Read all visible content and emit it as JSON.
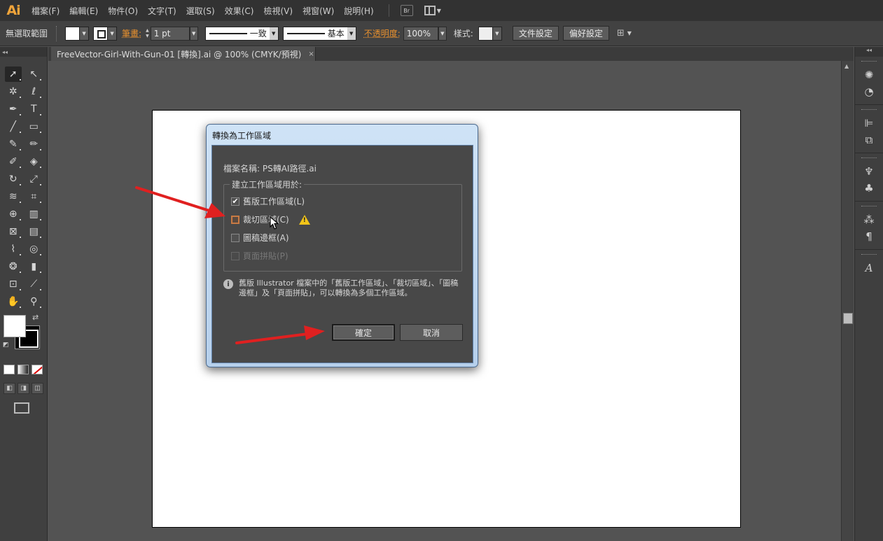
{
  "app": {
    "logo": "Ai"
  },
  "menubar": {
    "items": [
      "檔案(F)",
      "編輯(E)",
      "物件(O)",
      "文字(T)",
      "選取(S)",
      "效果(C)",
      "檢視(V)",
      "視窗(W)",
      "說明(H)"
    ],
    "bridge_label": "Br"
  },
  "controlbar": {
    "selection_label": "無選取範圍",
    "stroke_label": "筆畫:",
    "stroke_weight": "1 pt",
    "stroke_profile": "一致",
    "brush_label": "基本",
    "opacity_label": "不透明度:",
    "opacity_value": "100%",
    "style_label": "樣式:",
    "doc_setup_button": "文件設定",
    "preferences_button": "偏好設定"
  },
  "document": {
    "tab_title": "FreeVector-Girl-With-Gun-01 [轉換].ai @ 100% (CMYK/預視)",
    "close_glyph": "×"
  },
  "dialog": {
    "title": "轉換為工作區域",
    "filename_line": "檔案名稱: PS轉AI路徑.ai",
    "group_label": "建立工作區域用於:",
    "options": [
      {
        "label": "舊版工作區域(L)",
        "checked": true,
        "enabled": true
      },
      {
        "label": "裁切區域(C)",
        "checked": false,
        "enabled": true
      },
      {
        "label": "圖稿邊框(A)",
        "checked": false,
        "enabled": true
      },
      {
        "label": "頁面拼貼(P)",
        "checked": false,
        "enabled": false
      }
    ],
    "check_glyph": "✔",
    "info_glyph": "i",
    "warn_glyph": "!",
    "info_text": "舊版 Illustrator 檔案中的「舊版工作區域」、「裁切區域」、「圖稿邊框」及「頁面拼貼」，可以轉換為多個工作區域。",
    "ok_button": "確定",
    "cancel_button": "取消"
  },
  "colors": {
    "accent_orange": "#e8902e",
    "annotation_red": "#e02020",
    "warning_yellow": "#f2c418"
  }
}
